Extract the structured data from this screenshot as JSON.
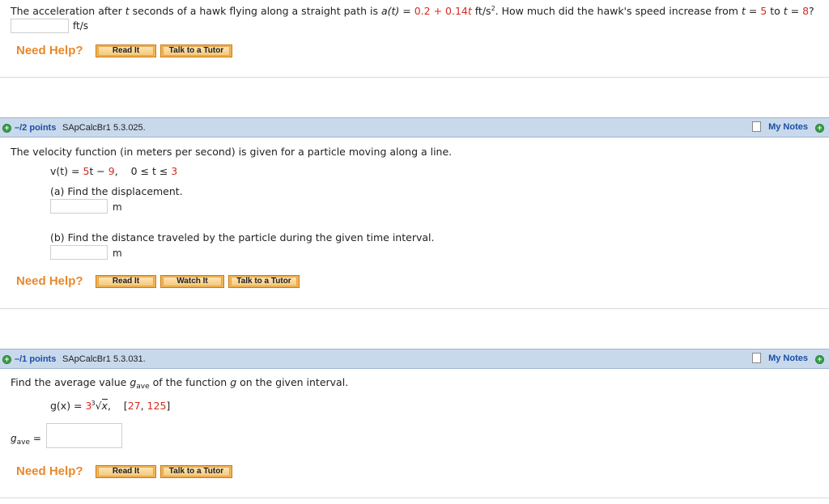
{
  "q1": {
    "text_pre": "The acceleration after ",
    "var_t": "t",
    "text_mid": " seconds of a hawk flying along a straight path is ",
    "func": "a(t) = ",
    "c0": "0.2",
    "plus": " + ",
    "c1": "0.14",
    "c1_var": "t",
    "units": " ft/s",
    "units_exp": "2",
    "text_q": ". How much did the hawk's speed increase from ",
    "from_eq": "t = ",
    "from_val": "5",
    "to_word": " to ",
    "to_eq": "t = ",
    "to_val": "8",
    "qmark": "?",
    "answer_unit": "ft/s"
  },
  "help_labels": {
    "need_help": "Need Help?",
    "read_it": "Read It",
    "watch_it": "Watch It",
    "talk_to_tutor": "Talk to a Tutor"
  },
  "q2": {
    "points": "–/2 points",
    "code": "SApCalcBr1 5.3.025.",
    "my_notes": "My Notes",
    "intro": "The velocity function (in meters per second) is given for a particle moving along a line.",
    "func_lhs": "v(t) = ",
    "coef": "5",
    "func_rest": "t − ",
    "const": "9",
    "domain_pre": ",    0 ≤ t ≤ ",
    "domain_max": "3",
    "part_a": "(a) Find the displacement.",
    "unit_a": "m",
    "part_b": "(b) Find the distance traveled by the particle during the given time interval.",
    "unit_b": "m"
  },
  "q3": {
    "points": "–/1 points",
    "code": "SApCalcBr1 5.3.031.",
    "my_notes": "My Notes",
    "intro_pre": "Find the average value ",
    "g": "g",
    "ave": "ave",
    "intro_post": " of the function ",
    "g2": "g",
    "intro_end": " on the given interval.",
    "func_lhs": "g(x) = ",
    "coef": "3",
    "root_index": "3",
    "radicand": "x",
    "interval_pre": ",    [",
    "a": "27",
    "comma": ", ",
    "b": "125",
    "interval_post": "]",
    "answer_label_g": "g",
    "answer_label_sub": "ave",
    "answer_label_eq": " ="
  },
  "colors": {
    "accent_red": "#d42a1e",
    "help_orange": "#e8882a",
    "bar_blue": "#c9d9ec",
    "link_blue": "#1a4ea5"
  }
}
